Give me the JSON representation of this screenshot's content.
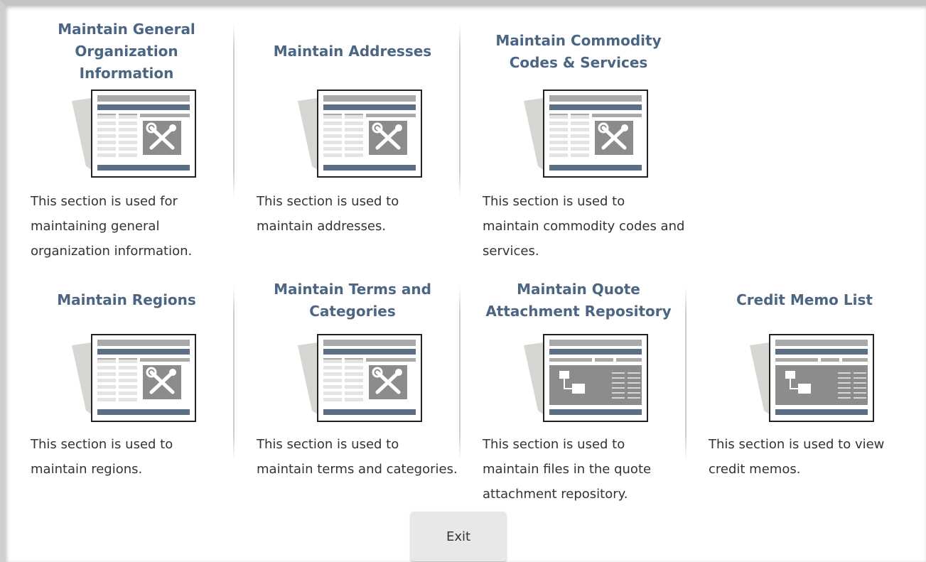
{
  "colors": {
    "title": "#4b6583",
    "desc": "#333333",
    "icon_dark": "#5b6e86",
    "icon_gray": "#a9a9a9",
    "icon_frame": "#222222"
  },
  "tiles": [
    {
      "title": "Maintain General Organization Information",
      "desc": "This section is used for maintaining general organization information.",
      "icon": "tools-page-icon"
    },
    {
      "title": "Maintain Addresses",
      "desc": "This section is used to maintain addresses.",
      "icon": "tools-page-icon"
    },
    {
      "title": "Maintain Commodity Codes & Services",
      "desc": "This section is used to maintain commodity codes and services.",
      "icon": "tools-page-icon"
    },
    {
      "title": "Maintain Regions",
      "desc": "This section is used to maintain regions.",
      "icon": "tools-page-icon"
    },
    {
      "title": "Maintain Terms and Categories",
      "desc": "This section is used to maintain terms and categories.",
      "icon": "tools-page-icon"
    },
    {
      "title": "Maintain Quote Attachment Repository",
      "desc": "This section is used to maintain files in the quote attachment repository.",
      "icon": "folder-page-icon"
    },
    {
      "title": "Credit Memo List",
      "desc": "This section is used to view credit memos.",
      "icon": "folder-page-icon"
    }
  ],
  "exit_label": "Exit"
}
